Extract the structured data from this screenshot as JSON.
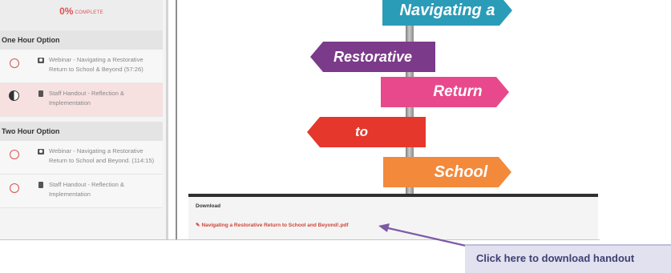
{
  "progress": {
    "percent": "0%",
    "label": "COMPLETE"
  },
  "sections": [
    {
      "title": "One Hour Option",
      "items": [
        {
          "status": "not-started",
          "type_icon": "video-icon",
          "title": "Webinar - Navigating a Restorative Return to School & Beyond (57:26)"
        },
        {
          "status": "in-progress",
          "type_icon": "document-icon",
          "title": "Staff Handout - Reflection & Implementation"
        }
      ]
    },
    {
      "title": "Two Hour Option",
      "items": [
        {
          "status": "not-started",
          "type_icon": "video-icon",
          "title": "Webinar - Navigating a Restorative Return to School and Beyond. (114:15)"
        },
        {
          "status": "not-started",
          "type_icon": "document-icon",
          "title": "Staff Handout - Reflection & Implementation"
        }
      ]
    }
  ],
  "signs": {
    "line1": "Navigating a",
    "line2": "Restorative",
    "line3": "Return",
    "line4": "to",
    "line5": "School",
    "colors": {
      "teal": "#2a9cb8",
      "purple": "#7b3a8a",
      "pink": "#e8498c",
      "red": "#e5372b",
      "orange": "#f3893b"
    }
  },
  "download": {
    "heading": "Download",
    "icon": "paperclip-icon",
    "file_link": "Navigating a Restorative Return to School and Beyond!.pdf"
  },
  "annotation": {
    "text": "Click here to download handout",
    "arrow_color": "#7b5aa6"
  }
}
